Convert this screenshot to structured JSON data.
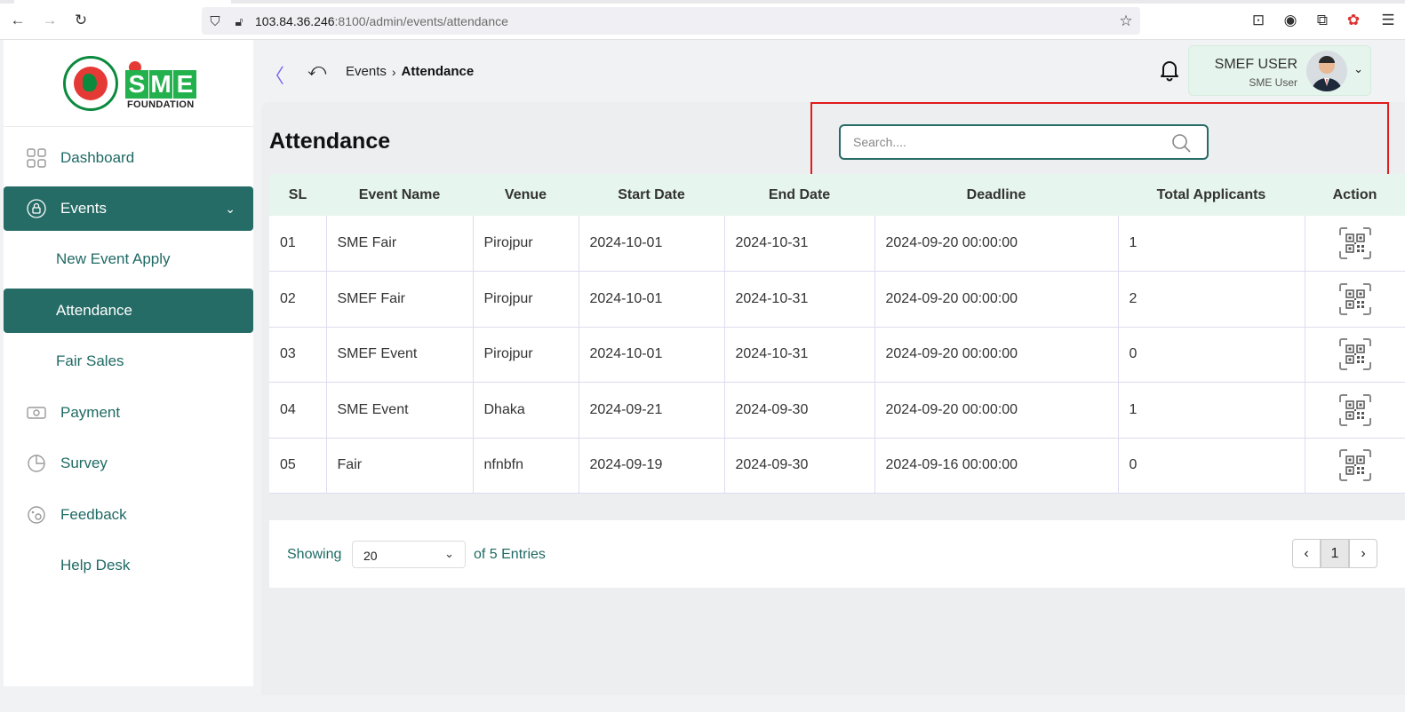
{
  "browser": {
    "url_host": "103.84.36.246",
    "url_rest": ":8100/admin/events/attendance"
  },
  "brand": {
    "logo_text": "SME",
    "logo_subtext": "FOUNDATION",
    "accent": "#256b66",
    "highlight": "#e01b1b"
  },
  "sidebar": {
    "items": [
      {
        "label": "Dashboard",
        "icon": "grid-icon"
      },
      {
        "label": "Events",
        "icon": "lock-circle-icon",
        "active": true
      },
      {
        "label": "New Event Apply",
        "sub": true
      },
      {
        "label": "Attendance",
        "sub": true,
        "active": true
      },
      {
        "label": "Fair Sales",
        "sub": true
      },
      {
        "label": "Payment",
        "icon": "money-icon"
      },
      {
        "label": "Survey",
        "icon": "pie-chart-icon"
      },
      {
        "label": "Feedback",
        "icon": "feedback-icon"
      },
      {
        "label": "Help Desk"
      }
    ]
  },
  "header": {
    "breadcrumb": [
      "Events",
      "Attendance"
    ],
    "user_name": "SMEF USER",
    "user_role": "SME User"
  },
  "page": {
    "title": "Attendance",
    "search_placeholder": "Search...."
  },
  "table": {
    "columns": [
      "SL",
      "Event Name",
      "Venue",
      "Start Date",
      "End Date",
      "Deadline",
      "Total Applicants",
      "Action"
    ],
    "rows": [
      [
        "01",
        "SME Fair",
        "Pirojpur",
        "2024-10-01",
        "2024-10-31",
        "2024-09-20 00:00:00",
        "1"
      ],
      [
        "02",
        "SMEF Fair",
        "Pirojpur",
        "2024-10-01",
        "2024-10-31",
        "2024-09-20 00:00:00",
        "2"
      ],
      [
        "03",
        "SMEF Event",
        "Pirojpur",
        "2024-10-01",
        "2024-10-31",
        "2024-09-20 00:00:00",
        "0"
      ],
      [
        "04",
        "SME Event",
        "Dhaka",
        "2024-09-21",
        "2024-09-30",
        "2024-09-20 00:00:00",
        "1"
      ],
      [
        "05",
        "Fair",
        "nfnbfn",
        "2024-09-19",
        "2024-09-30",
        "2024-09-16 00:00:00",
        "0"
      ]
    ]
  },
  "pagination": {
    "showing_label": "Showing",
    "per_page": "20",
    "entries_label": "of 5 Entries",
    "current_page": "1"
  }
}
